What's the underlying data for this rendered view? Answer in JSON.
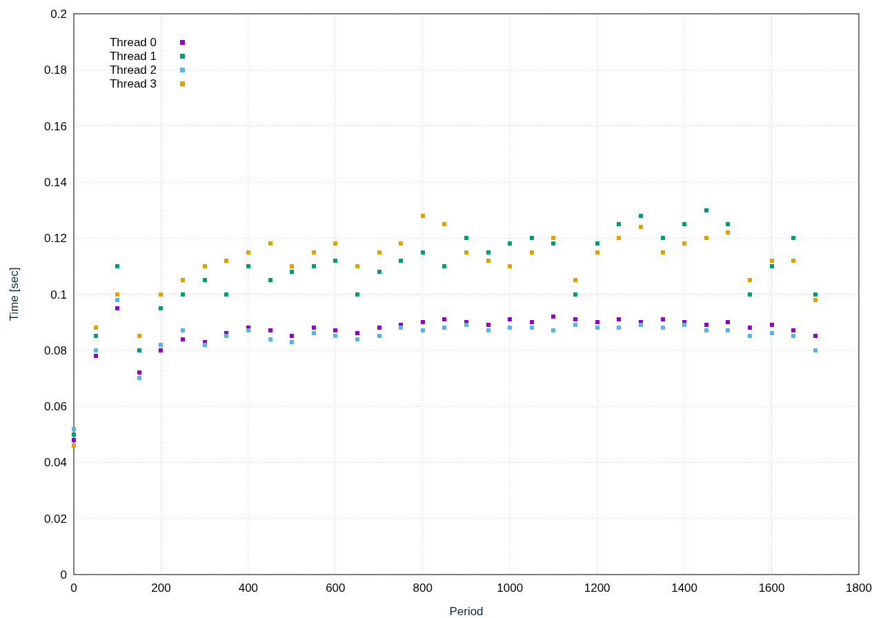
{
  "chart_data": {
    "type": "scatter",
    "grid": true,
    "legend": "top-left",
    "xlabel": "Period",
    "ylabel": "Time [sec]",
    "x": [
      0,
      50,
      100,
      150,
      200,
      250,
      300,
      350,
      400,
      450,
      500,
      550,
      600,
      650,
      700,
      750,
      800,
      850,
      900,
      950,
      1000,
      1050,
      1100,
      1150,
      1200,
      1250,
      1300,
      1350,
      1400,
      1450,
      1500,
      1550,
      1600,
      1650,
      1700
    ],
    "series": [
      {
        "name": "Thread 0",
        "color": "#9400d3",
        "values": [
          0.048,
          0.078,
          0.095,
          0.072,
          0.08,
          0.084,
          0.083,
          0.086,
          0.088,
          0.087,
          0.085,
          0.088,
          0.087,
          0.086,
          0.088,
          0.089,
          0.09,
          0.091,
          0.09,
          0.089,
          0.091,
          0.09,
          0.092,
          0.091,
          0.09,
          0.091,
          0.09,
          0.091,
          0.09,
          0.089,
          0.09,
          0.088,
          0.089,
          0.087,
          0.085
        ]
      },
      {
        "name": "Thread 1",
        "color": "#009e73",
        "values": [
          0.05,
          0.085,
          0.11,
          0.08,
          0.095,
          0.1,
          0.105,
          0.1,
          0.11,
          0.105,
          0.108,
          0.11,
          0.112,
          0.1,
          0.108,
          0.112,
          0.115,
          0.11,
          0.12,
          0.115,
          0.118,
          0.12,
          0.118,
          0.1,
          0.118,
          0.125,
          0.128,
          0.12,
          0.125,
          0.13,
          0.125,
          0.1,
          0.11,
          0.12,
          0.1
        ]
      },
      {
        "name": "Thread 2",
        "color": "#56b4e9",
        "values": [
          0.052,
          0.08,
          0.098,
          0.07,
          0.082,
          0.087,
          0.082,
          0.085,
          0.087,
          0.084,
          0.083,
          0.086,
          0.085,
          0.084,
          0.085,
          0.088,
          0.087,
          0.088,
          0.089,
          0.087,
          0.088,
          0.088,
          0.087,
          0.089,
          0.088,
          0.088,
          0.089,
          0.088,
          0.089,
          0.087,
          0.087,
          0.085,
          0.086,
          0.085,
          0.08
        ]
      },
      {
        "name": "Thread 3",
        "color": "#e69f00",
        "values": [
          0.046,
          0.088,
          0.1,
          0.085,
          0.1,
          0.105,
          0.11,
          0.112,
          0.115,
          0.118,
          0.11,
          0.115,
          0.118,
          0.11,
          0.115,
          0.118,
          0.128,
          0.125,
          0.115,
          0.112,
          0.11,
          0.115,
          0.12,
          0.105,
          0.115,
          0.12,
          0.124,
          0.115,
          0.118,
          0.12,
          0.122,
          0.105,
          0.112,
          0.112,
          0.098
        ]
      }
    ],
    "xlim": [
      0,
      1800
    ],
    "ylim": [
      0,
      0.2
    ],
    "xticks": [
      0,
      200,
      400,
      600,
      800,
      1000,
      1200,
      1400,
      1600,
      1800
    ],
    "yticks": [
      0,
      0.02,
      0.04,
      0.06,
      0.08,
      0.1,
      0.12,
      0.14,
      0.16,
      0.18,
      0.2
    ]
  }
}
